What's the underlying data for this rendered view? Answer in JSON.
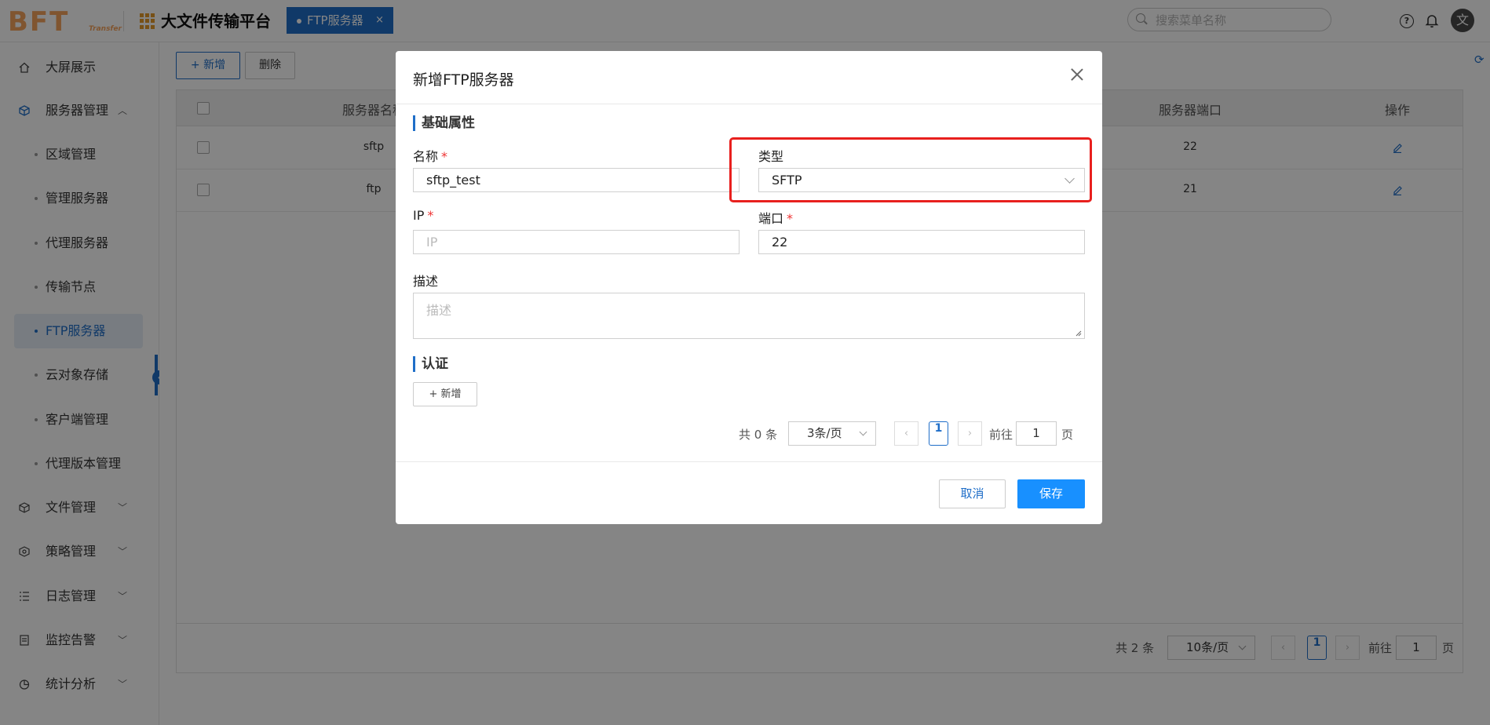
{
  "header": {
    "logo_big": "BFT",
    "logo_small": "Transfer",
    "app_title": "大文件传输平台",
    "tab_label": "FTP服务器",
    "tab_close": "×",
    "search_placeholder": "搜索菜单名称",
    "help_icon": "?",
    "avatar_text": "文"
  },
  "sidebar": {
    "items": [
      {
        "label": "大屏展示",
        "icon": "home-icon"
      },
      {
        "label": "服务器管理",
        "icon": "cube-icon",
        "chevron": "︿"
      },
      {
        "label": "文件管理",
        "icon": "cube-icon",
        "chevron": "﹀"
      },
      {
        "label": "策略管理",
        "icon": "gear-cube-icon",
        "chevron": "﹀"
      },
      {
        "label": "日志管理",
        "icon": "list-icon",
        "chevron": "﹀"
      },
      {
        "label": "监控告警",
        "icon": "monitor-icon",
        "chevron": "﹀"
      },
      {
        "label": "统计分析",
        "icon": "pie-chart-icon",
        "chevron": "﹀"
      }
    ],
    "subitems": [
      "区域管理",
      "管理服务器",
      "代理服务器",
      "传输节点",
      "FTP服务器",
      "云对象存储",
      "客户端管理",
      "代理版本管理"
    ],
    "active_subitem": "FTP服务器",
    "collapse_icon": "‹"
  },
  "main": {
    "add_button": "+ 新增",
    "delete_button": "删除",
    "refresh_icon": "⟳",
    "table": {
      "headers": [
        "服务器名称",
        "服务器端口",
        "操作"
      ],
      "rows": [
        {
          "name": "sftp",
          "port": "22"
        },
        {
          "name": "ftp",
          "port": "21"
        }
      ]
    },
    "pagination": {
      "total": "共 2 条",
      "page_size": "10条/页",
      "prev": "‹",
      "current": "1",
      "next": "›",
      "goto_label": "前往",
      "goto_value": "1",
      "page_suffix": "页"
    }
  },
  "modal": {
    "title": "新增FTP服务器",
    "section_basic": "基础属性",
    "name_label": "名称",
    "name_value": "sftp_test",
    "type_label": "类型",
    "type_value": "SFTP",
    "ip_label": "IP",
    "ip_placeholder": "IP",
    "port_label": "端口",
    "port_value": "22",
    "desc_label": "描述",
    "desc_placeholder": "描述",
    "required_mark": "*",
    "section_auth": "认证",
    "auth_add_button": "+ 新增",
    "pagination": {
      "total": "共 0 条",
      "page_size": "3条/页",
      "prev": "‹",
      "current": "1",
      "next": "›",
      "goto_label": "前往",
      "goto_value": "1",
      "page_suffix": "页"
    },
    "cancel_button": "取消",
    "save_button": "保存"
  },
  "colors": {
    "accent": "#1f6ec8",
    "primary_button": "#1890ff",
    "highlight_border": "#e8201e",
    "logo": "#f6a35c",
    "overlay": "rgba(0,0,0,0.48)"
  }
}
